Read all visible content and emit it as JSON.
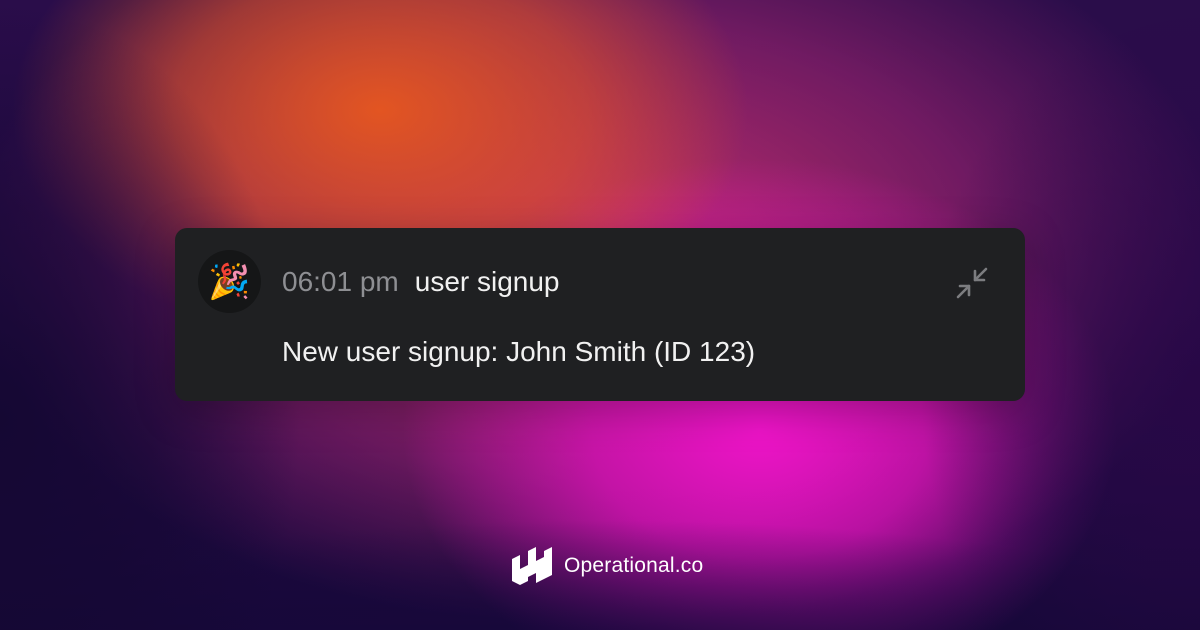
{
  "notification": {
    "avatar_icon": "party-popper-icon",
    "avatar_glyph": "🎉",
    "time": "06:01 pm",
    "event_name": "user signup",
    "message": "New user signup: John Smith (ID 123)",
    "collapse_icon": "collapse-arrows-icon"
  },
  "brand": {
    "logo_icon": "operational-logo-icon",
    "name": "Operational.co"
  },
  "colors": {
    "card_background": "#1f2022",
    "time_text": "#8e8f93",
    "primary_text": "#f1f1f1",
    "accent_orange": "#e8581e",
    "accent_magenta": "#ee14c8"
  }
}
